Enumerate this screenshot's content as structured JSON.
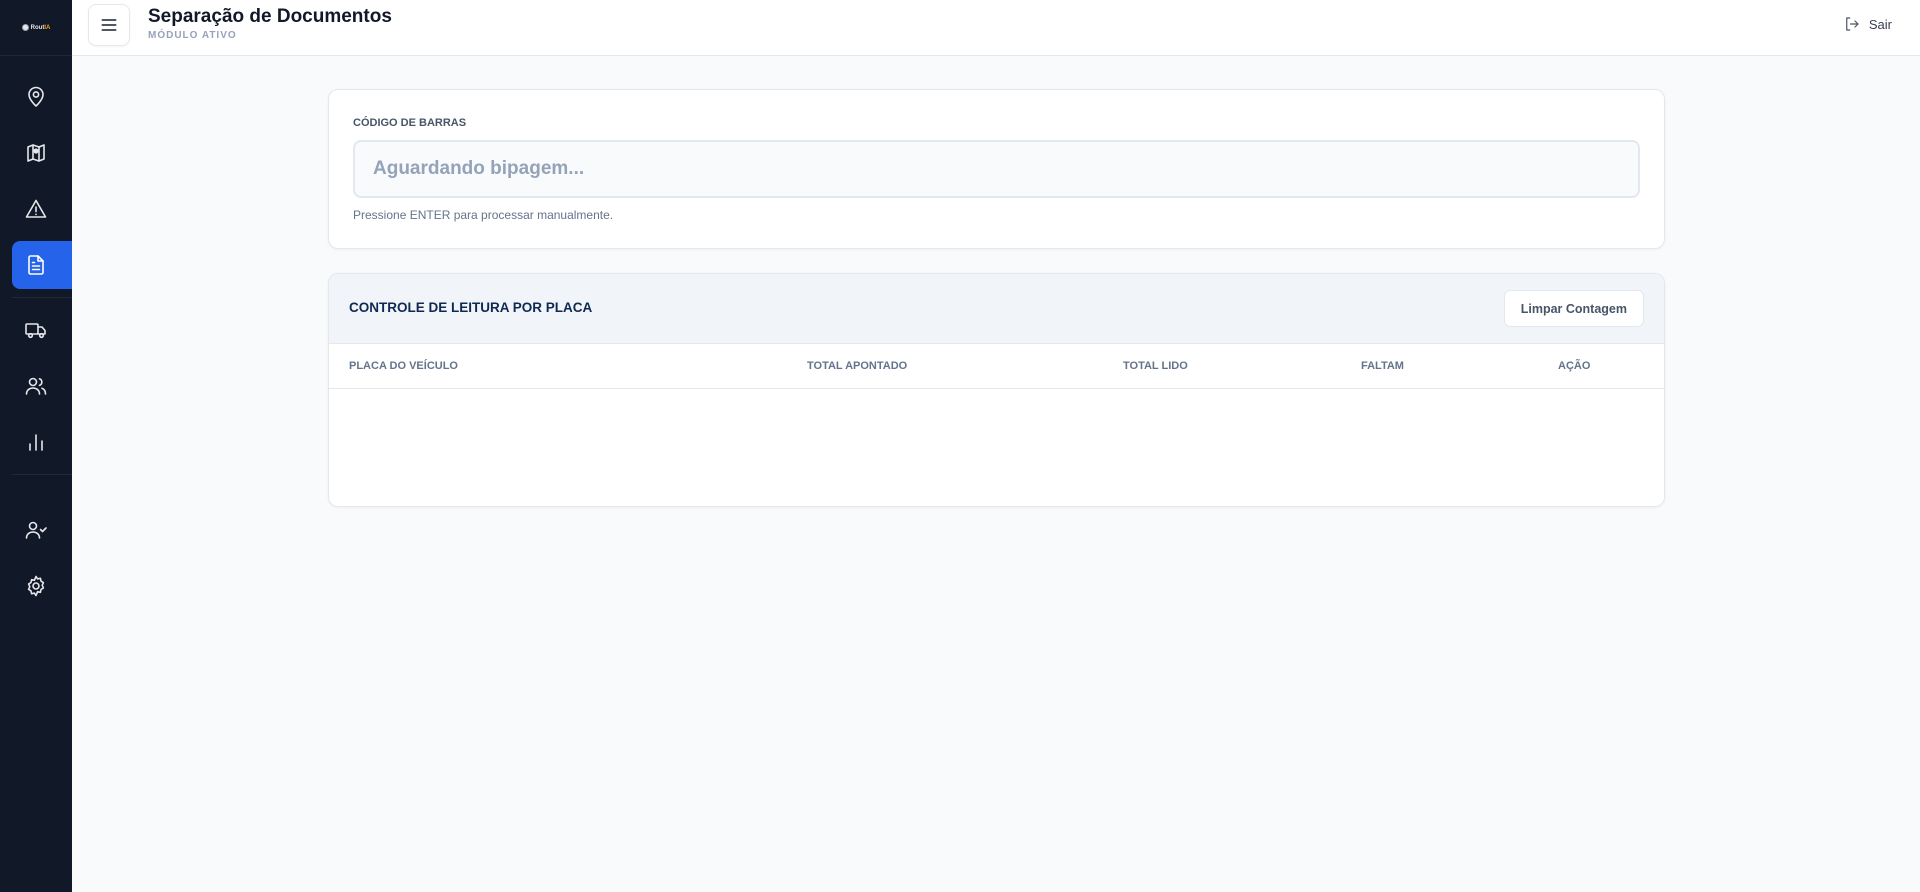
{
  "sidebar": {
    "logo": {
      "text_main": "Rout",
      "text_accent": "IA",
      "subtext": ""
    },
    "items": [
      {
        "icon": "map-pin-icon",
        "active": false
      },
      {
        "icon": "map-icon",
        "active": false
      },
      {
        "icon": "alert-triangle-icon",
        "active": false
      },
      {
        "icon": "file-text-icon",
        "active": true
      },
      {
        "icon": "truck-icon",
        "active": false
      },
      {
        "icon": "users-icon",
        "active": false
      },
      {
        "icon": "bar-chart-icon",
        "active": false
      },
      {
        "icon": "user-check-icon",
        "active": false
      },
      {
        "icon": "settings-icon",
        "active": false
      }
    ]
  },
  "header": {
    "title": "Separação de Documentos",
    "subtitle": "MÓDULO ATIVO",
    "logout_label": "Sair"
  },
  "scan": {
    "label": "CÓDIGO DE BARRAS",
    "value": "",
    "placeholder": "Aguardando bipagem...",
    "hint": "Pressione ENTER para processar manualmente."
  },
  "plate_table": {
    "title": "CONTROLE DE LEITURA POR PLACA",
    "clear_label": "Limpar Contagem",
    "columns": [
      "PLACA DO VEÍCULO",
      "TOTAL APONTADO",
      "TOTAL LIDO",
      "FALTAM",
      "AÇÃO"
    ],
    "rows": []
  },
  "colors": {
    "sidebar_bg": "#111827",
    "accent": "#2563eb",
    "page_bg": "#f8fafc",
    "title_navy": "#0f2952"
  }
}
